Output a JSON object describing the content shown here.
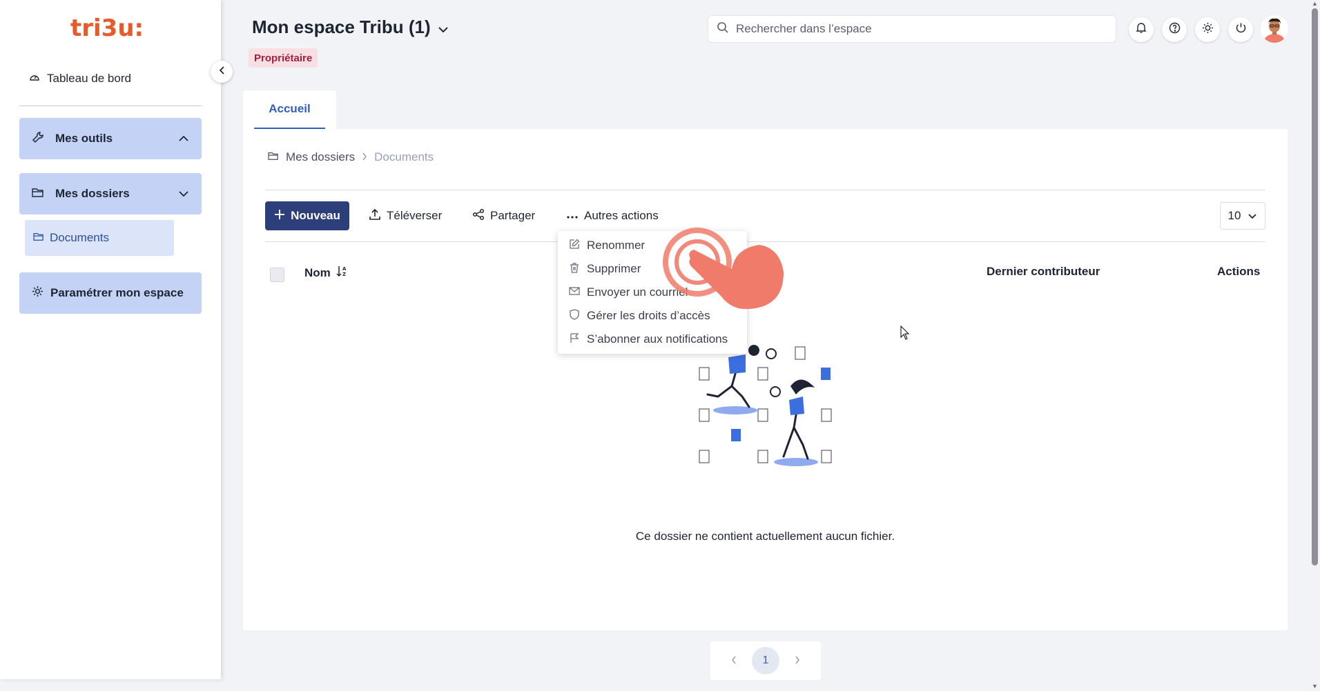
{
  "sidebar": {
    "logo_text": "tri3u:",
    "dashboard_label": "Tableau de bord",
    "tools_label": "Mes outils",
    "folders_label": "Mes dossiers",
    "folders_items": [
      {
        "label": "Documents"
      }
    ],
    "settings_label": "Paramétrer mon espace"
  },
  "header": {
    "space_title": "Mon espace Tribu (1)",
    "role_badge": "Propriétaire",
    "search_placeholder": "Rechercher dans l’espace"
  },
  "tabs": [
    {
      "label": "Accueil",
      "active": true
    }
  ],
  "breadcrumb": {
    "root": "Mes dossiers",
    "current": "Documents"
  },
  "toolbar": {
    "new_label": "Nouveau",
    "upload_label": "Téléverser",
    "share_label": "Partager",
    "more_label": "Autres actions",
    "page_size": "10"
  },
  "table": {
    "headers": {
      "name": "Nom",
      "last_contributor": "Dernier contributeur",
      "actions": "Actions"
    }
  },
  "more_actions_menu": [
    {
      "label": "Renommer",
      "icon": "edit-icon"
    },
    {
      "label": "Supprimer",
      "icon": "trash-icon"
    },
    {
      "label": "Envoyer un courriel",
      "icon": "mail-icon"
    },
    {
      "label": "Gérer les droits d’accès",
      "icon": "shield-icon"
    },
    {
      "label": "S’abonner aux notifications",
      "icon": "flag-icon"
    }
  ],
  "empty_message": "Ce dossier ne contient actuellement aucun fichier.",
  "pagination": {
    "current_page": "1"
  },
  "colors": {
    "accent": "#2c3f7a",
    "tab_active": "#2f5fbf",
    "sidebar_button": "#c4d3f5",
    "role_badge_bg": "#f8dfe4",
    "role_badge_text": "#a3203c",
    "illustration_blue": "#3b6fe0",
    "tap_indicator": "#f07b6a"
  }
}
